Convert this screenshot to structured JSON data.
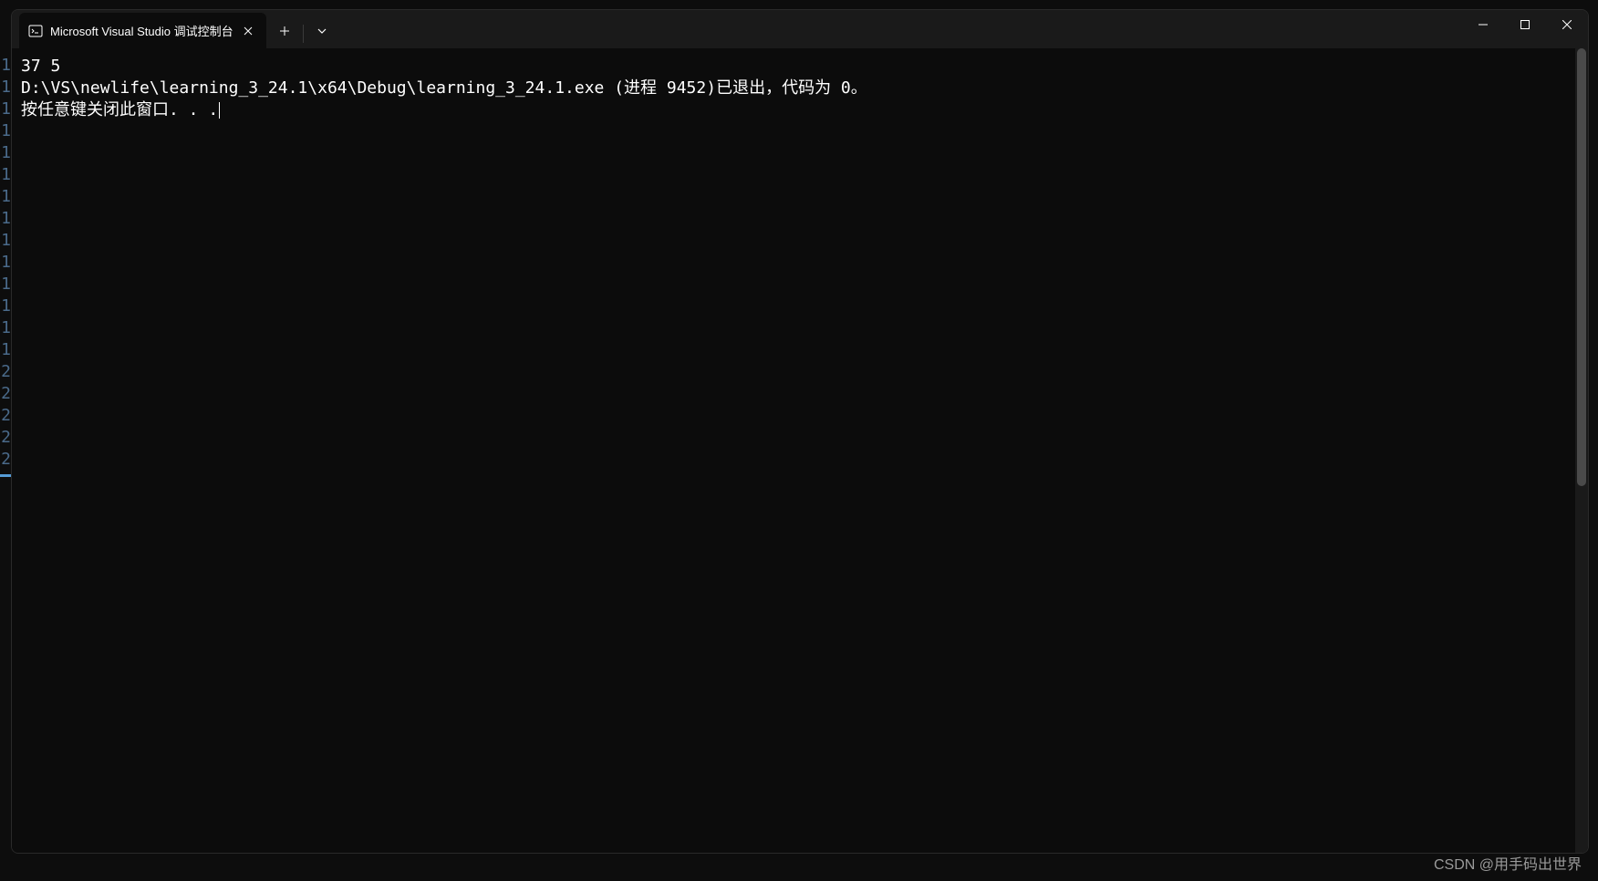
{
  "tab": {
    "title": "Microsoft Visual Studio 调试控制台"
  },
  "console": {
    "line1": "37 5",
    "line2": "",
    "line3": "D:\\VS\\newlife\\learning_3_24.1\\x64\\Debug\\learning_3_24.1.exe (进程 9452)已退出，代码为 0。",
    "line4": "按任意键关闭此窗口. . ."
  },
  "line_numbers": [
    "1",
    "1",
    "1",
    "1",
    "1",
    "1",
    "1",
    "1",
    "1",
    "1",
    "1",
    "1",
    "1",
    "1",
    "2",
    "2",
    "2",
    "2",
    "2"
  ],
  "watermark": "CSDN @用手码出世界"
}
